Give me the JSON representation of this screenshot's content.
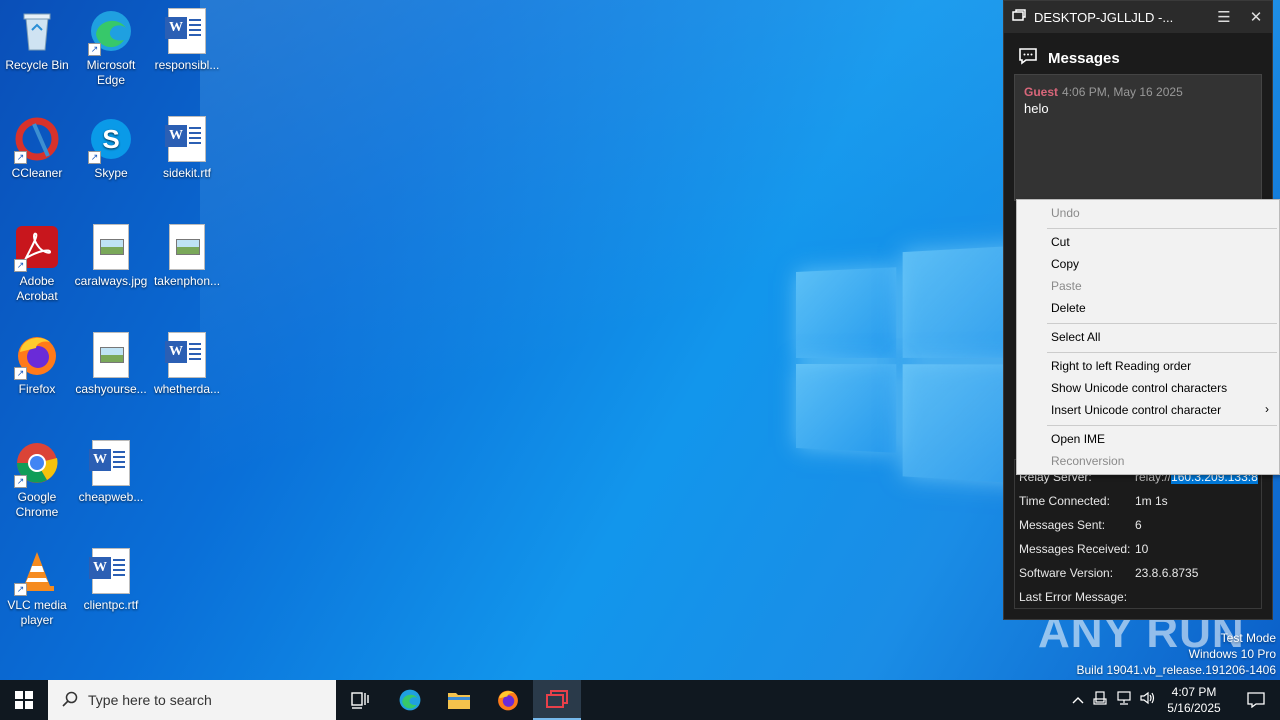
{
  "desktop_icons": [
    {
      "label": "Recycle Bin",
      "icon": "recycle-bin-icon"
    },
    {
      "label": "Microsoft Edge",
      "icon": "edge-icon"
    },
    {
      "label": "responsibl...",
      "icon": "word-doc-icon"
    },
    {
      "label": "CCleaner",
      "icon": "ccleaner-icon"
    },
    {
      "label": "Skype",
      "icon": "skype-icon"
    },
    {
      "label": "sidekit.rtf",
      "icon": "word-doc-icon"
    },
    {
      "label": "Adobe Acrobat",
      "icon": "acrobat-icon"
    },
    {
      "label": "caralways.jpg",
      "icon": "image-file-icon"
    },
    {
      "label": "takenphon...",
      "icon": "image-file-icon"
    },
    {
      "label": "Firefox",
      "icon": "firefox-icon"
    },
    {
      "label": "cashyourse...",
      "icon": "image-file-icon"
    },
    {
      "label": "whetherda...",
      "icon": "word-doc-icon"
    },
    {
      "label": "Google Chrome",
      "icon": "chrome-icon"
    },
    {
      "label": "cheapweb...",
      "icon": "word-doc-icon"
    },
    {
      "label": "VLC media player",
      "icon": "vlc-icon"
    },
    {
      "label": "clientpc.rtf",
      "icon": "word-doc-icon"
    }
  ],
  "window": {
    "title": "DESKTOP-JGLLJLD -...",
    "messages_title": "Messages",
    "message": {
      "sender": "Guest",
      "time": "4:06 PM, May 16 2025",
      "text": "helo"
    },
    "stats": [
      {
        "key": "Relay Server:",
        "value_prefix": "relay://",
        "value_selected": "160.3.209.133:8"
      },
      {
        "key": "Time Connected:",
        "value": "1m 1s"
      },
      {
        "key": "Messages Sent:",
        "value": "6"
      },
      {
        "key": "Messages Received:",
        "value": "10"
      },
      {
        "key": "Software Version:",
        "value": "23.8.6.8735"
      },
      {
        "key": "Last Error Message:",
        "value": ""
      }
    ]
  },
  "context_menu": {
    "undo": "Undo",
    "cut": "Cut",
    "copy": "Copy",
    "paste": "Paste",
    "delete": "Delete",
    "select_all": "Select All",
    "rtl": "Right to left Reading order",
    "show_unicode": "Show Unicode control characters",
    "insert_unicode": "Insert Unicode control character",
    "open_ime": "Open IME",
    "reconversion": "Reconversion"
  },
  "taskbar": {
    "search_placeholder": "Type here to search",
    "time": "4:07 PM",
    "date": "5/16/2025"
  },
  "watermark": {
    "brand": "ANY RUN",
    "line1": "Test Mode",
    "line2": "Windows 10 Pro",
    "line3": "Build 19041.vb_release.191206-1406"
  },
  "colors": {
    "accent": "#0078d7",
    "guest_name": "#d9667a",
    "taskbar": "#101820"
  }
}
